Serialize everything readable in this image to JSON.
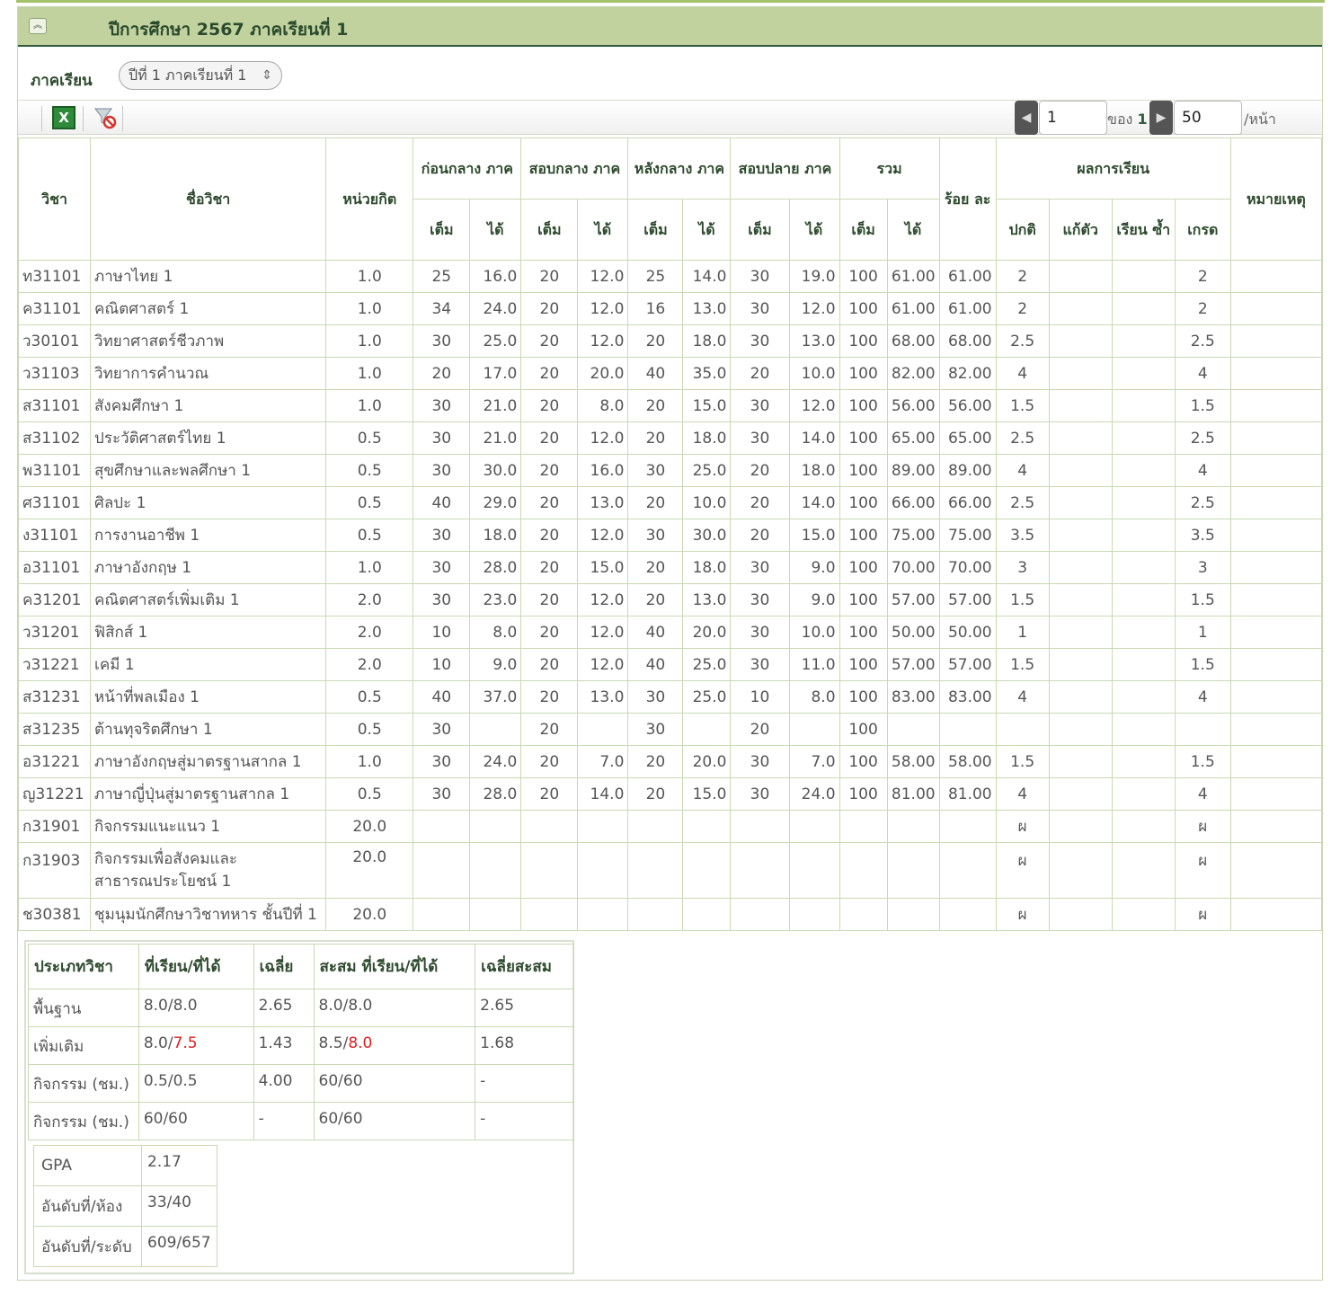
{
  "header": {
    "title": "ปีการศึกษา 2567 ภาคเรียนที่ 1"
  },
  "term": {
    "label": "ภาคเรียน",
    "selected": "ปีที่ 1 ภาคเรียนที่ 1"
  },
  "toolbar": {
    "excel_icon": "excel-icon",
    "clear_filter_icon": "filter-off-icon"
  },
  "pager": {
    "page": "1",
    "of_label": "ของ",
    "total_pages": "1",
    "page_size": "50",
    "per_page_label": "/หน้า"
  },
  "table": {
    "headers": {
      "code": "วิชา",
      "name": "ชื่อวิชา",
      "credit": "หน่วยกิต",
      "before_mid": "ก่อนกลาง ภาค",
      "mid": "สอบกลาง ภาค",
      "after_mid": "หลังกลาง ภาค",
      "final": "สอบปลาย ภาค",
      "total": "รวม",
      "percent": "ร้อย ละ",
      "result": "ผลการเรียน",
      "remark": "หมายเหตุ",
      "full": "เต็ม",
      "got": "ได้",
      "normal": "ปกติ",
      "fix": "แก้ตัว",
      "repeat": "เรียน ซ้ำ",
      "grade": "เกรด"
    },
    "rows": [
      {
        "code": "ท31101",
        "name": "ภาษาไทย 1",
        "credit": "1.0",
        "bm_f": "25",
        "bm_g": "16.0",
        "m_f": "20",
        "m_g": "12.0",
        "am_f": "25",
        "am_g": "14.0",
        "f_f": "30",
        "f_g": "19.0",
        "t_f": "100",
        "t_g": "61.00",
        "pct": "61.00",
        "normal": "2",
        "fix": "",
        "repeat": "",
        "grade": "2",
        "remark": ""
      },
      {
        "code": "ค31101",
        "name": "คณิตศาสตร์ 1",
        "credit": "1.0",
        "bm_f": "34",
        "bm_g": "24.0",
        "m_f": "20",
        "m_g": "12.0",
        "am_f": "16",
        "am_g": "13.0",
        "f_f": "30",
        "f_g": "12.0",
        "t_f": "100",
        "t_g": "61.00",
        "pct": "61.00",
        "normal": "2",
        "fix": "",
        "repeat": "",
        "grade": "2",
        "remark": ""
      },
      {
        "code": "ว30101",
        "name": "วิทยาศาสตร์ชีวภาพ",
        "credit": "1.0",
        "bm_f": "30",
        "bm_g": "25.0",
        "m_f": "20",
        "m_g": "12.0",
        "am_f": "20",
        "am_g": "18.0",
        "f_f": "30",
        "f_g": "13.0",
        "t_f": "100",
        "t_g": "68.00",
        "pct": "68.00",
        "normal": "2.5",
        "fix": "",
        "repeat": "",
        "grade": "2.5",
        "remark": ""
      },
      {
        "code": "ว31103",
        "name": "วิทยาการคำนวณ",
        "credit": "1.0",
        "bm_f": "20",
        "bm_g": "17.0",
        "m_f": "20",
        "m_g": "20.0",
        "am_f": "40",
        "am_g": "35.0",
        "f_f": "20",
        "f_g": "10.0",
        "t_f": "100",
        "t_g": "82.00",
        "pct": "82.00",
        "normal": "4",
        "fix": "",
        "repeat": "",
        "grade": "4",
        "remark": ""
      },
      {
        "code": "ส31101",
        "name": "สังคมศึกษา 1",
        "credit": "1.0",
        "bm_f": "30",
        "bm_g": "21.0",
        "m_f": "20",
        "m_g": "8.0",
        "am_f": "20",
        "am_g": "15.0",
        "f_f": "30",
        "f_g": "12.0",
        "t_f": "100",
        "t_g": "56.00",
        "pct": "56.00",
        "normal": "1.5",
        "fix": "",
        "repeat": "",
        "grade": "1.5",
        "remark": ""
      },
      {
        "code": "ส31102",
        "name": "ประวัติศาสตร์ไทย 1",
        "credit": "0.5",
        "bm_f": "30",
        "bm_g": "21.0",
        "m_f": "20",
        "m_g": "12.0",
        "am_f": "20",
        "am_g": "18.0",
        "f_f": "30",
        "f_g": "14.0",
        "t_f": "100",
        "t_g": "65.00",
        "pct": "65.00",
        "normal": "2.5",
        "fix": "",
        "repeat": "",
        "grade": "2.5",
        "remark": ""
      },
      {
        "code": "พ31101",
        "name": "สุขศึกษาและพลศึกษา 1",
        "credit": "0.5",
        "bm_f": "30",
        "bm_g": "30.0",
        "m_f": "20",
        "m_g": "16.0",
        "am_f": "30",
        "am_g": "25.0",
        "f_f": "20",
        "f_g": "18.0",
        "t_f": "100",
        "t_g": "89.00",
        "pct": "89.00",
        "normal": "4",
        "fix": "",
        "repeat": "",
        "grade": "4",
        "remark": ""
      },
      {
        "code": "ศ31101",
        "name": "ศิลปะ 1",
        "credit": "0.5",
        "bm_f": "40",
        "bm_g": "29.0",
        "m_f": "20",
        "m_g": "13.0",
        "am_f": "20",
        "am_g": "10.0",
        "f_f": "20",
        "f_g": "14.0",
        "t_f": "100",
        "t_g": "66.00",
        "pct": "66.00",
        "normal": "2.5",
        "fix": "",
        "repeat": "",
        "grade": "2.5",
        "remark": ""
      },
      {
        "code": "ง31101",
        "name": "การงานอาชีพ 1",
        "credit": "0.5",
        "bm_f": "30",
        "bm_g": "18.0",
        "m_f": "20",
        "m_g": "12.0",
        "am_f": "30",
        "am_g": "30.0",
        "f_f": "20",
        "f_g": "15.0",
        "t_f": "100",
        "t_g": "75.00",
        "pct": "75.00",
        "normal": "3.5",
        "fix": "",
        "repeat": "",
        "grade": "3.5",
        "remark": ""
      },
      {
        "code": "อ31101",
        "name": "ภาษาอังกฤษ 1",
        "credit": "1.0",
        "bm_f": "30",
        "bm_g": "28.0",
        "m_f": "20",
        "m_g": "15.0",
        "am_f": "20",
        "am_g": "18.0",
        "f_f": "30",
        "f_g": "9.0",
        "t_f": "100",
        "t_g": "70.00",
        "pct": "70.00",
        "normal": "3",
        "fix": "",
        "repeat": "",
        "grade": "3",
        "remark": ""
      },
      {
        "code": "ค31201",
        "name": "คณิตศาสตร์เพิ่มเติม 1",
        "credit": "2.0",
        "bm_f": "30",
        "bm_g": "23.0",
        "m_f": "20",
        "m_g": "12.0",
        "am_f": "20",
        "am_g": "13.0",
        "f_f": "30",
        "f_g": "9.0",
        "t_f": "100",
        "t_g": "57.00",
        "pct": "57.00",
        "normal": "1.5",
        "fix": "",
        "repeat": "",
        "grade": "1.5",
        "remark": ""
      },
      {
        "code": "ว31201",
        "name": "ฟิสิกส์ 1",
        "credit": "2.0",
        "bm_f": "10",
        "bm_g": "8.0",
        "m_f": "20",
        "m_g": "12.0",
        "am_f": "40",
        "am_g": "20.0",
        "f_f": "30",
        "f_g": "10.0",
        "t_f": "100",
        "t_g": "50.00",
        "pct": "50.00",
        "normal": "1",
        "fix": "",
        "repeat": "",
        "grade": "1",
        "remark": ""
      },
      {
        "code": "ว31221",
        "name": "เคมี 1",
        "credit": "2.0",
        "bm_f": "10",
        "bm_g": "9.0",
        "m_f": "20",
        "m_g": "12.0",
        "am_f": "40",
        "am_g": "25.0",
        "f_f": "30",
        "f_g": "11.0",
        "t_f": "100",
        "t_g": "57.00",
        "pct": "57.00",
        "normal": "1.5",
        "fix": "",
        "repeat": "",
        "grade": "1.5",
        "remark": ""
      },
      {
        "code": "ส31231",
        "name": "หน้าที่พลเมือง 1",
        "credit": "0.5",
        "bm_f": "40",
        "bm_g": "37.0",
        "m_f": "20",
        "m_g": "13.0",
        "am_f": "30",
        "am_g": "25.0",
        "f_f": "10",
        "f_g": "8.0",
        "t_f": "100",
        "t_g": "83.00",
        "pct": "83.00",
        "normal": "4",
        "fix": "",
        "repeat": "",
        "grade": "4",
        "remark": ""
      },
      {
        "code": "ส31235",
        "name": "ต้านทุจริตศึกษา 1",
        "credit": "0.5",
        "bm_f": "30",
        "bm_g": "",
        "m_f": "20",
        "m_g": "",
        "am_f": "30",
        "am_g": "",
        "f_f": "20",
        "f_g": "",
        "t_f": "100",
        "t_g": "",
        "pct": "",
        "normal": "",
        "fix": "",
        "repeat": "",
        "grade": "",
        "remark": ""
      },
      {
        "code": "อ31221",
        "name": "ภาษาอังกฤษสู่มาตรฐานสากล 1",
        "credit": "1.0",
        "bm_f": "30",
        "bm_g": "24.0",
        "m_f": "20",
        "m_g": "7.0",
        "am_f": "20",
        "am_g": "20.0",
        "f_f": "30",
        "f_g": "7.0",
        "t_f": "100",
        "t_g": "58.00",
        "pct": "58.00",
        "normal": "1.5",
        "fix": "",
        "repeat": "",
        "grade": "1.5",
        "remark": ""
      },
      {
        "code": "ญ31221",
        "name": "ภาษาญี่ปุ่นสู่มาตรฐานสากล 1",
        "credit": "0.5",
        "bm_f": "30",
        "bm_g": "28.0",
        "m_f": "20",
        "m_g": "14.0",
        "am_f": "20",
        "am_g": "15.0",
        "f_f": "30",
        "f_g": "24.0",
        "t_f": "100",
        "t_g": "81.00",
        "pct": "81.00",
        "normal": "4",
        "fix": "",
        "repeat": "",
        "grade": "4",
        "remark": ""
      },
      {
        "code": "ก31901",
        "name": "กิจกรรมแนะแนว 1",
        "credit": "20.0",
        "bm_f": "",
        "bm_g": "",
        "m_f": "",
        "m_g": "",
        "am_f": "",
        "am_g": "",
        "f_f": "",
        "f_g": "",
        "t_f": "",
        "t_g": "",
        "pct": "",
        "normal": "ผ",
        "fix": "",
        "repeat": "",
        "grade": "ผ",
        "remark": ""
      },
      {
        "code": "ก31903",
        "name": "กิจกรรมเพื่อสังคมและ สาธารณประโยชน์ 1",
        "credit": "20.0",
        "bm_f": "",
        "bm_g": "",
        "m_f": "",
        "m_g": "",
        "am_f": "",
        "am_g": "",
        "f_f": "",
        "f_g": "",
        "t_f": "",
        "t_g": "",
        "pct": "",
        "normal": "ผ",
        "fix": "",
        "repeat": "",
        "grade": "ผ",
        "remark": ""
      },
      {
        "code": "ช30381",
        "name": "ชุมนุมนักศึกษาวิชาทหาร ชั้นปีที่ 1",
        "credit": "20.0",
        "bm_f": "",
        "bm_g": "",
        "m_f": "",
        "m_g": "",
        "am_f": "",
        "am_g": "",
        "f_f": "",
        "f_g": "",
        "t_f": "",
        "t_g": "",
        "pct": "",
        "normal": "ผ",
        "fix": "",
        "repeat": "",
        "grade": "ผ",
        "remark": ""
      }
    ]
  },
  "summary": {
    "headers": [
      "ประเภทวิชา",
      "ที่เรียน/ที่ได้",
      "เฉลี่ย",
      "สะสม ที่เรียน/ที่ได้",
      "เฉลี่ยสะสม"
    ],
    "rows": [
      {
        "type": "พื้นฐาน",
        "sem_a": "8.0/",
        "sem_b": "8.0",
        "sem_b_color": "#555555",
        "avg": "2.65",
        "cum_a": "8.0/",
        "cum_b": "8.0",
        "cum_b_color": "#555555",
        "cum_avg": "2.65"
      },
      {
        "type": "เพิ่มเติม",
        "sem_a": "8.0/",
        "sem_b": "7.5",
        "sem_b_color": "#e02020",
        "avg": "1.43",
        "cum_a": "8.5/",
        "cum_b": "8.0",
        "cum_b_color": "#e02020",
        "cum_avg": "1.68"
      },
      {
        "type": "กิจกรรม (ชม.)",
        "sem_a": "0.5/",
        "sem_b": "0.5",
        "sem_b_color": "#555555",
        "avg": "4.00",
        "cum_a": "60/",
        "cum_b": "60",
        "cum_b_color": "#555555",
        "cum_avg": "-"
      },
      {
        "type": "กิจกรรม (ชม.)",
        "sem_a": "60/",
        "sem_b": "60",
        "sem_b_color": "#555555",
        "avg": "-",
        "cum_a": "60/",
        "cum_b": "60",
        "cum_b_color": "#555555",
        "cum_avg": "-"
      }
    ],
    "gpa": [
      {
        "label": "GPA",
        "value": "2.17"
      },
      {
        "label": "อันดับที่/ห้อง",
        "value": "33/40"
      },
      {
        "label": "อันดับที่/ระดับ",
        "value": "609/657"
      }
    ]
  }
}
